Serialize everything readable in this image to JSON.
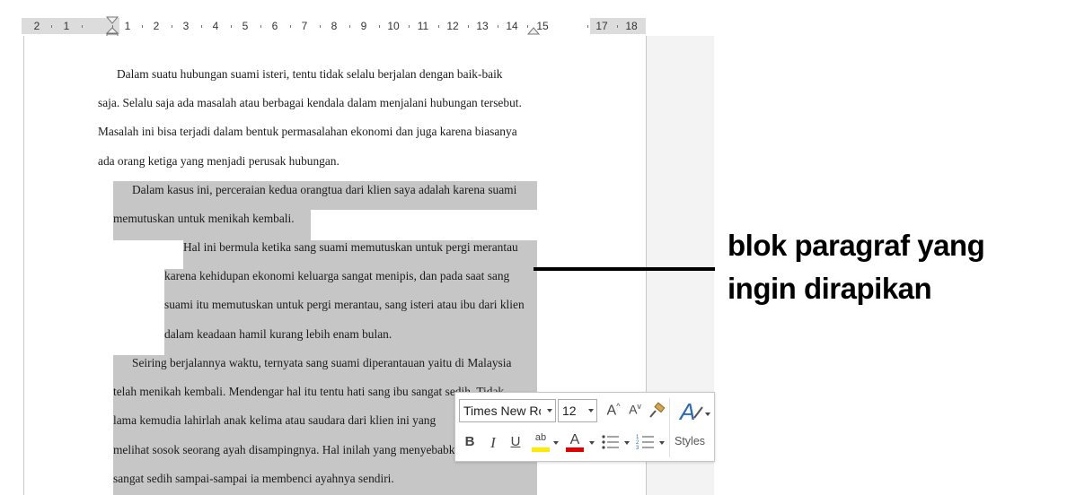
{
  "ruler": {
    "labels": [
      "2",
      "1",
      "1",
      "2",
      "3",
      "4",
      "5",
      "6",
      "7",
      "8",
      "9",
      "10",
      "11",
      "12",
      "13",
      "14",
      "15",
      "17",
      "18"
    ]
  },
  "document": {
    "lines": [
      "Dalam suatu hubungan suami isteri, tentu tidak selalu berjalan dengan baik-baik",
      "saja. Selalu saja ada masalah atau berbagai kendala dalam menjalani hubungan tersebut.",
      "Masalah ini bisa terjadi dalam bentuk permasalahan ekonomi dan juga karena biasanya",
      "ada orang ketiga yang menjadi perusak hubungan.",
      "Dalam kasus ini, perceraian kedua orangtua dari klien saya adalah karena suami",
      "memutuskan untuk menikah kembali.",
      "Hal ini bermula ketika sang suami memutuskan untuk pergi merantau",
      "karena kehidupan ekonomi keluarga sangat menipis, dan pada saat sang",
      "suami itu memutuskan untuk pergi merantau, sang isteri atau ibu dari klien",
      "dalam keadaan hamil kurang lebih enam bulan.",
      "Seiring berjalannya waktu, ternyata sang suami diperantauan yaitu di Malaysia",
      "telah menikah kembali. Mendengar hal itu tentu hati sang ibu sangat sedih. Tidak",
      "lama kemudia lahirlah anak kelima atau saudara dari klien ini yang",
      "melihat sosok seorang ayah disampingnya. Hal inilah yang menyebabkan",
      "sangat sedih sampai-sampai ia membenci ayahnya sendiri."
    ]
  },
  "annotation": {
    "line1": "blok paragraf yang",
    "line2": "ingin dirapikan"
  },
  "mini_toolbar": {
    "font_name": "Times New Roman",
    "font_size": "12",
    "grow_font": "A",
    "shrink_font": "A",
    "bold": "B",
    "italic": "I",
    "underline": "U",
    "highlight": "ab",
    "font_color": "A",
    "styles_label": "Styles",
    "highlight_color": "#ffeb00",
    "font_color_bar": "#e00000"
  }
}
